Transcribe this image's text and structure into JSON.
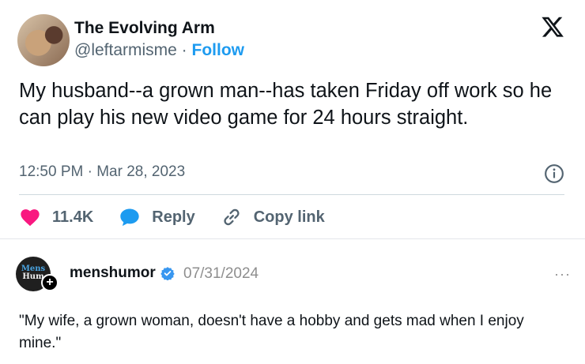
{
  "tweet": {
    "author_name": "The Evolving Arm",
    "handle": "@leftarmisme",
    "separator": " · ",
    "follow_label": "Follow",
    "text": "My husband--a grown man--has taken Friday off work so he can play his new video game for 24 hours straight.",
    "timestamp": "12:50 PM · Mar 28, 2023",
    "likes": "11.4K",
    "reply_label": "Reply",
    "copy_link_label": "Copy link",
    "icons": [
      "x-logo-icon",
      "info-icon",
      "heart-icon",
      "reply-bubble-icon",
      "link-icon"
    ],
    "colors": {
      "like": "#f91880",
      "reply": "#1d9bf0",
      "follow": "#1d9bf0",
      "muted": "#536471"
    }
  },
  "comment": {
    "avatar_text_top": "Mens",
    "avatar_text_bottom": "Hum",
    "username": "menshumor",
    "date": "07/31/2024",
    "more": "···",
    "plus": "+",
    "text": "\"My wife, a grown woman, doesn't have a hobby and gets mad when I enjoy mine.\"",
    "icons": [
      "verified-badge-icon",
      "more-icon",
      "plus-icon"
    ],
    "colors": {
      "verified": "#3897f0"
    }
  }
}
